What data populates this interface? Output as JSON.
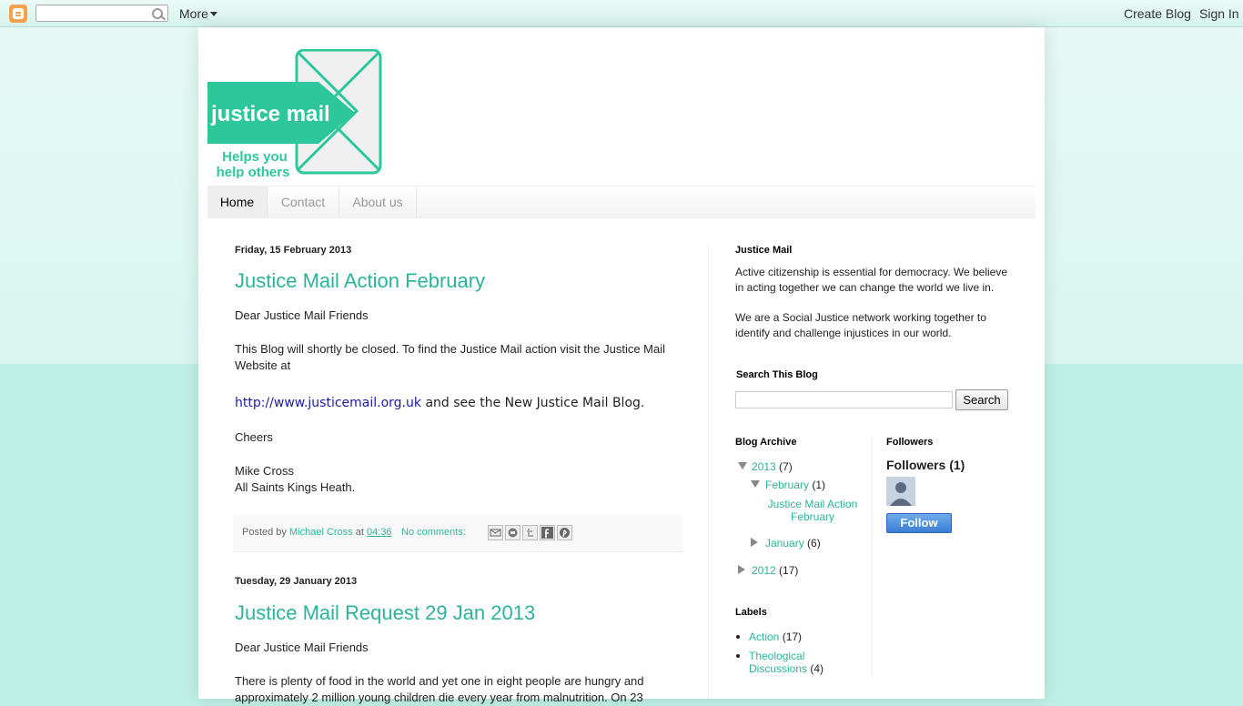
{
  "navbar": {
    "search_placeholder": "",
    "more_label": "More",
    "create_blog_label": "Create Blog",
    "sign_in_label": "Sign In"
  },
  "header": {
    "logo_text": "justice mail",
    "logo_tagline_1": "Helps you",
    "logo_tagline_2": "help others"
  },
  "tabs": [
    {
      "label": "Home",
      "active": true
    },
    {
      "label": "Contact",
      "active": false
    },
    {
      "label": "About us",
      "active": false
    }
  ],
  "posts": [
    {
      "date": "Friday, 15 February 2013",
      "title": "Justice Mail Action February",
      "greeting": "Dear Justice Mail Friends",
      "para1": "This Blog will shortly be closed. To find the Justice Mail action visit the Justice Mail Website at",
      "link": "http://www.justicemail.org.uk",
      "link_suffix": " and see the New Justice Mail Blog.",
      "cheers": "Cheers",
      "sign_1": "Mike Cross",
      "sign_2": "All Saints Kings Heath.",
      "footer": {
        "posted_by": "Posted by ",
        "author": "Michael Cross",
        "at": " at ",
        "time": "04:36",
        "comments": "No comments:"
      }
    },
    {
      "date": "Tuesday, 29 January 2013",
      "title": "Justice Mail Request 29 Jan 2013",
      "greeting": "Dear Justice Mail Friends",
      "para1": "There is plenty of food in the world and yet one in eight people are hungry and approximately 2 million young children die every year from malnutrition. On 23"
    }
  ],
  "sidebar": {
    "about_title": "Justice Mail",
    "about_p1": "Active citizenship is essential for democracy. We believe in acting together we can change the world we live in.",
    "about_p2": "We are a Social Justice network working together to identify and challenge injustices in our world.",
    "search_title": "Search This Blog",
    "search_button": "Search",
    "archive_title": "Blog Archive",
    "archive": {
      "y2013": "2013",
      "y2013_count": "(7)",
      "feb": "February",
      "feb_count": "(1)",
      "feb_post": "Justice Mail Action February",
      "jan": "January",
      "jan_count": "(6)",
      "y2012": "2012",
      "y2012_count": "(17)"
    },
    "followers_title": "Followers",
    "followers_count_label": "Followers (1)",
    "follow_button": "Follow",
    "labels_title": "Labels",
    "labels": [
      {
        "name": "Action",
        "count": "(17)"
      },
      {
        "name": "Theological Discussions",
        "count": "(4)"
      }
    ]
  },
  "colors": {
    "accent": "#2cb39a",
    "background": "#bff0e5",
    "link": "#1a1aa6"
  }
}
